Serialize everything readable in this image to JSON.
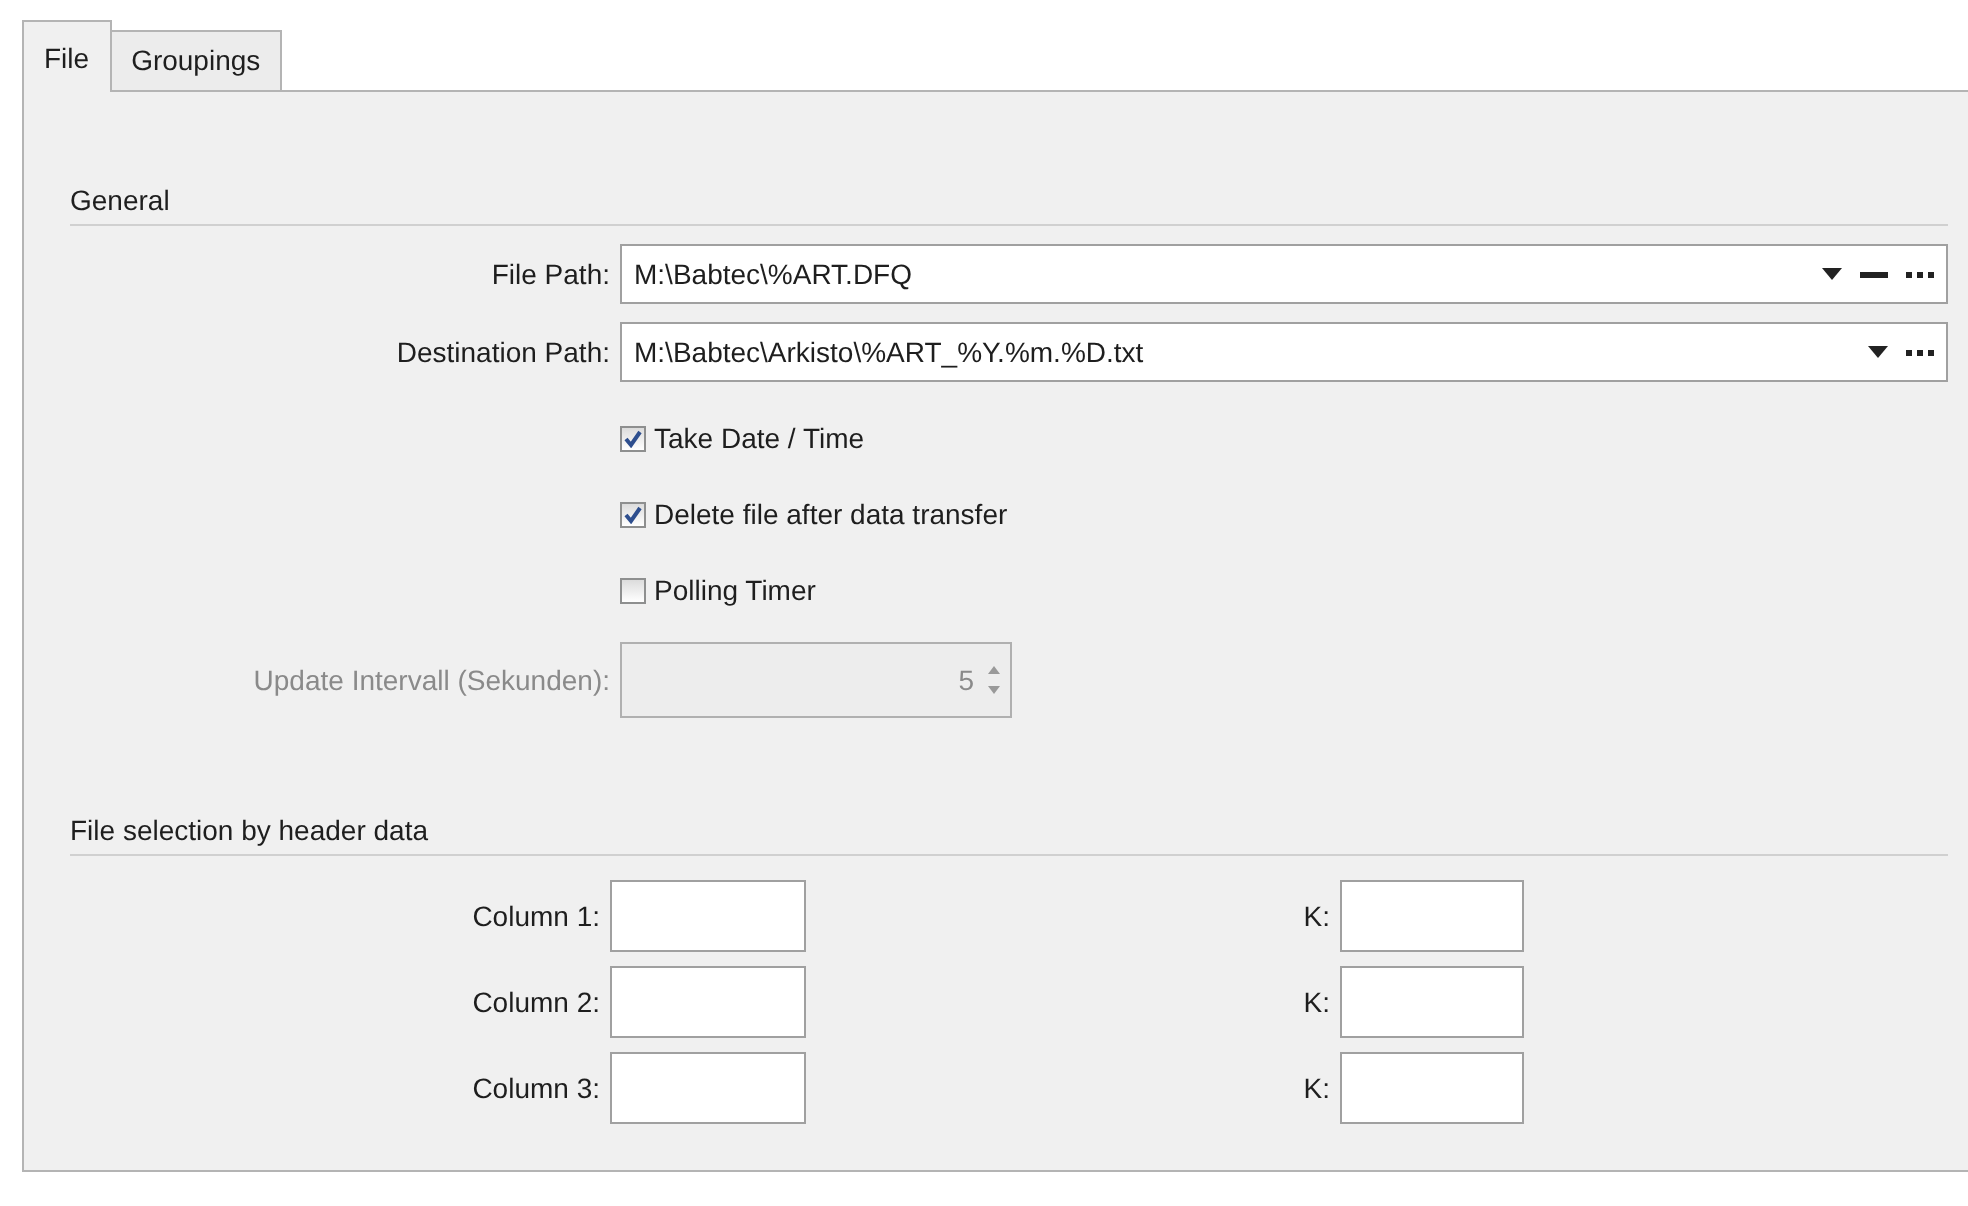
{
  "tabs": [
    {
      "label": "File",
      "selected": true
    },
    {
      "label": "Groupings",
      "selected": false
    }
  ],
  "general": {
    "title": "General",
    "paths": [
      {
        "label": "File Path:",
        "value": "M:\\Babtec\\%ART.DFQ",
        "actions": [
          {
            "kind": "dropdown"
          },
          {
            "kind": "clear"
          },
          {
            "kind": "browse"
          }
        ]
      },
      {
        "label": "Destination Path:",
        "value": "M:\\Babtec\\Arkisto\\%ART_%Y.%m.%D.txt",
        "actions": [
          {
            "kind": "dropdown"
          },
          {
            "kind": "browse"
          }
        ]
      }
    ],
    "options": [
      {
        "label": "Take Date / Time",
        "checked": true
      },
      {
        "label": "Delete file after data transfer",
        "checked": true
      },
      {
        "label": "Polling Timer",
        "checked": false
      }
    ],
    "interval": {
      "label": "Update Intervall (Sekunden):",
      "value": "5",
      "disabled": true
    }
  },
  "header_selection": {
    "title": "File selection by header data",
    "rows": [
      {
        "label": "Column 1:",
        "k_label": "K:"
      },
      {
        "label": "Column 2:",
        "k_label": "K:"
      },
      {
        "label": "Column 3:",
        "k_label": "K:"
      }
    ]
  }
}
